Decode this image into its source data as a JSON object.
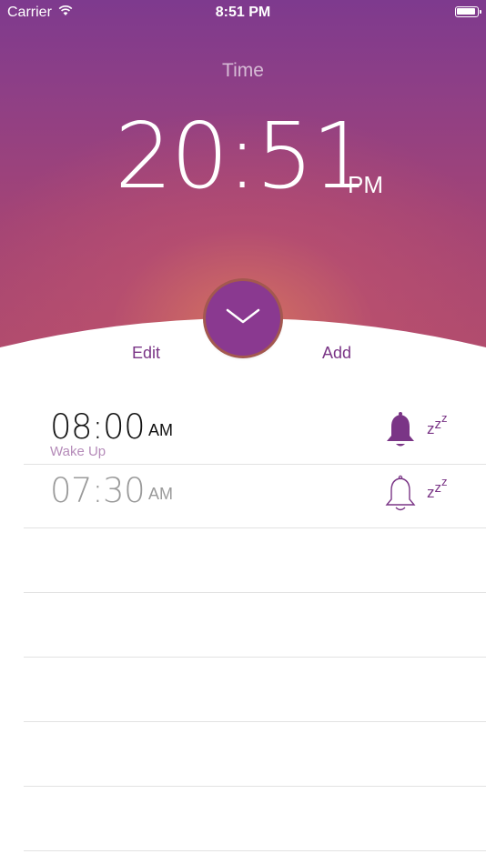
{
  "status_bar": {
    "carrier": "Carrier",
    "time": "8:51 PM"
  },
  "header": {
    "label": "Time",
    "time": "20:51",
    "ampm": "PM"
  },
  "actions": {
    "edit": "Edit",
    "add": "Add"
  },
  "alarms": [
    {
      "time": "08:00",
      "ampm": "AM",
      "label": "Wake Up",
      "enabled": true
    },
    {
      "time": "07:30",
      "ampm": "AM",
      "label": "",
      "enabled": false
    }
  ],
  "colors": {
    "accent": "#7a3586",
    "label_muted": "#b58bb9"
  }
}
